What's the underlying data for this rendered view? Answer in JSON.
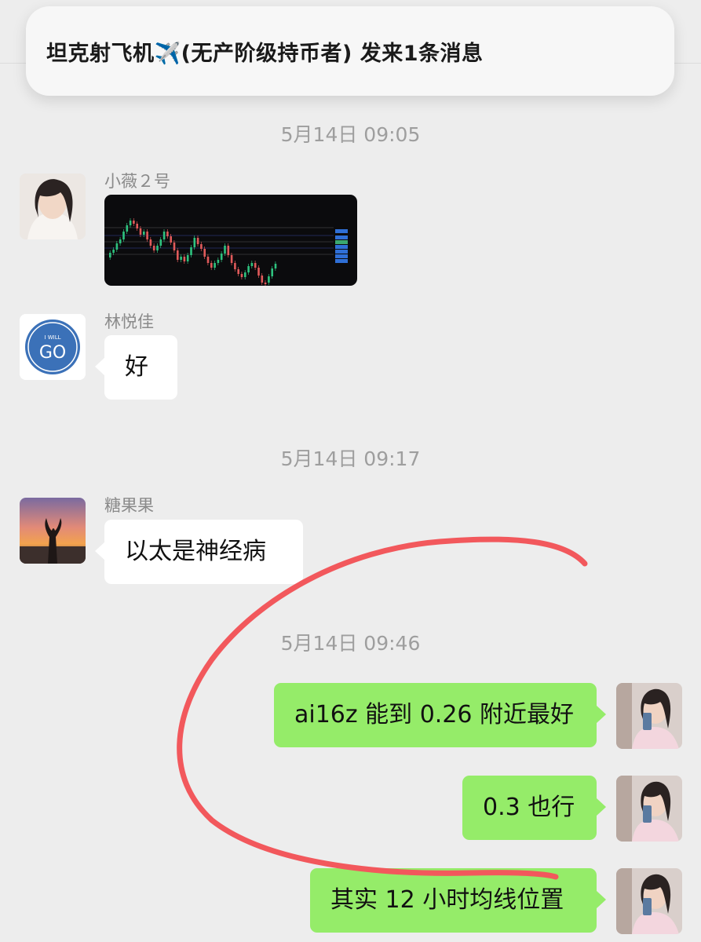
{
  "notification": {
    "text": "坦克射飞机✈️(无产阶级持币者) 发来1条消息"
  },
  "timestamps": [
    "5月14日 09:05",
    "5月14日 09:17",
    "5月14日 09:46"
  ],
  "messages": [
    {
      "sender": "小薇２号",
      "type": "image"
    },
    {
      "sender": "林悦佳",
      "text": "好"
    },
    {
      "sender": "糖果果",
      "text": "以太是神经病"
    },
    {
      "text": "ai16z 能到 0.26 附近最好"
    },
    {
      "text": "0.3 也行"
    },
    {
      "text": "其实 12 小时均线位置"
    }
  ],
  "avatars": {
    "go_logo_top": "I WILL",
    "go_logo_main": "GO"
  },
  "colors": {
    "background": "#ededed",
    "outgoing_bubble": "#95ec69",
    "incoming_bubble": "#ffffff",
    "annotation_stroke": "#f2585c"
  }
}
